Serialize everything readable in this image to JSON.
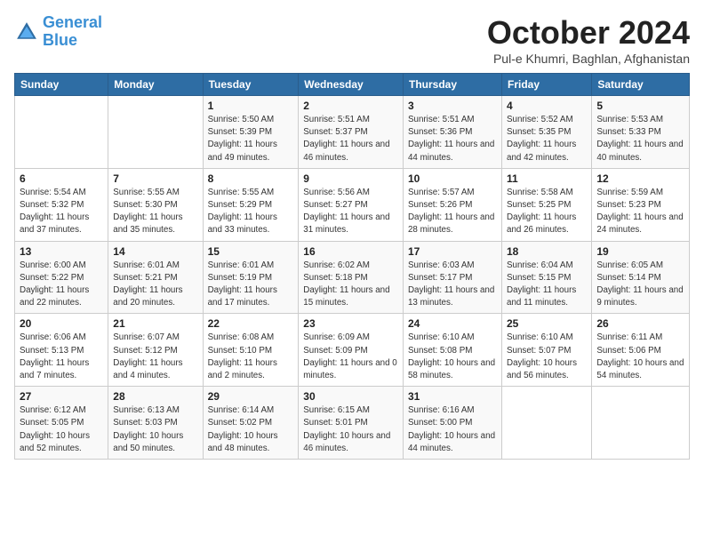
{
  "logo": {
    "line1": "General",
    "line2": "Blue"
  },
  "title": "October 2024",
  "subtitle": "Pul-e Khumri, Baghlan, Afghanistan",
  "weekdays": [
    "Sunday",
    "Monday",
    "Tuesday",
    "Wednesday",
    "Thursday",
    "Friday",
    "Saturday"
  ],
  "weeks": [
    [
      null,
      null,
      {
        "day": "1",
        "sunrise": "Sunrise: 5:50 AM",
        "sunset": "Sunset: 5:39 PM",
        "daylight": "Daylight: 11 hours and 49 minutes."
      },
      {
        "day": "2",
        "sunrise": "Sunrise: 5:51 AM",
        "sunset": "Sunset: 5:37 PM",
        "daylight": "Daylight: 11 hours and 46 minutes."
      },
      {
        "day": "3",
        "sunrise": "Sunrise: 5:51 AM",
        "sunset": "Sunset: 5:36 PM",
        "daylight": "Daylight: 11 hours and 44 minutes."
      },
      {
        "day": "4",
        "sunrise": "Sunrise: 5:52 AM",
        "sunset": "Sunset: 5:35 PM",
        "daylight": "Daylight: 11 hours and 42 minutes."
      },
      {
        "day": "5",
        "sunrise": "Sunrise: 5:53 AM",
        "sunset": "Sunset: 5:33 PM",
        "daylight": "Daylight: 11 hours and 40 minutes."
      }
    ],
    [
      {
        "day": "6",
        "sunrise": "Sunrise: 5:54 AM",
        "sunset": "Sunset: 5:32 PM",
        "daylight": "Daylight: 11 hours and 37 minutes."
      },
      {
        "day": "7",
        "sunrise": "Sunrise: 5:55 AM",
        "sunset": "Sunset: 5:30 PM",
        "daylight": "Daylight: 11 hours and 35 minutes."
      },
      {
        "day": "8",
        "sunrise": "Sunrise: 5:55 AM",
        "sunset": "Sunset: 5:29 PM",
        "daylight": "Daylight: 11 hours and 33 minutes."
      },
      {
        "day": "9",
        "sunrise": "Sunrise: 5:56 AM",
        "sunset": "Sunset: 5:27 PM",
        "daylight": "Daylight: 11 hours and 31 minutes."
      },
      {
        "day": "10",
        "sunrise": "Sunrise: 5:57 AM",
        "sunset": "Sunset: 5:26 PM",
        "daylight": "Daylight: 11 hours and 28 minutes."
      },
      {
        "day": "11",
        "sunrise": "Sunrise: 5:58 AM",
        "sunset": "Sunset: 5:25 PM",
        "daylight": "Daylight: 11 hours and 26 minutes."
      },
      {
        "day": "12",
        "sunrise": "Sunrise: 5:59 AM",
        "sunset": "Sunset: 5:23 PM",
        "daylight": "Daylight: 11 hours and 24 minutes."
      }
    ],
    [
      {
        "day": "13",
        "sunrise": "Sunrise: 6:00 AM",
        "sunset": "Sunset: 5:22 PM",
        "daylight": "Daylight: 11 hours and 22 minutes."
      },
      {
        "day": "14",
        "sunrise": "Sunrise: 6:01 AM",
        "sunset": "Sunset: 5:21 PM",
        "daylight": "Daylight: 11 hours and 20 minutes."
      },
      {
        "day": "15",
        "sunrise": "Sunrise: 6:01 AM",
        "sunset": "Sunset: 5:19 PM",
        "daylight": "Daylight: 11 hours and 17 minutes."
      },
      {
        "day": "16",
        "sunrise": "Sunrise: 6:02 AM",
        "sunset": "Sunset: 5:18 PM",
        "daylight": "Daylight: 11 hours and 15 minutes."
      },
      {
        "day": "17",
        "sunrise": "Sunrise: 6:03 AM",
        "sunset": "Sunset: 5:17 PM",
        "daylight": "Daylight: 11 hours and 13 minutes."
      },
      {
        "day": "18",
        "sunrise": "Sunrise: 6:04 AM",
        "sunset": "Sunset: 5:15 PM",
        "daylight": "Daylight: 11 hours and 11 minutes."
      },
      {
        "day": "19",
        "sunrise": "Sunrise: 6:05 AM",
        "sunset": "Sunset: 5:14 PM",
        "daylight": "Daylight: 11 hours and 9 minutes."
      }
    ],
    [
      {
        "day": "20",
        "sunrise": "Sunrise: 6:06 AM",
        "sunset": "Sunset: 5:13 PM",
        "daylight": "Daylight: 11 hours and 7 minutes."
      },
      {
        "day": "21",
        "sunrise": "Sunrise: 6:07 AM",
        "sunset": "Sunset: 5:12 PM",
        "daylight": "Daylight: 11 hours and 4 minutes."
      },
      {
        "day": "22",
        "sunrise": "Sunrise: 6:08 AM",
        "sunset": "Sunset: 5:10 PM",
        "daylight": "Daylight: 11 hours and 2 minutes."
      },
      {
        "day": "23",
        "sunrise": "Sunrise: 6:09 AM",
        "sunset": "Sunset: 5:09 PM",
        "daylight": "Daylight: 11 hours and 0 minutes."
      },
      {
        "day": "24",
        "sunrise": "Sunrise: 6:10 AM",
        "sunset": "Sunset: 5:08 PM",
        "daylight": "Daylight: 10 hours and 58 minutes."
      },
      {
        "day": "25",
        "sunrise": "Sunrise: 6:10 AM",
        "sunset": "Sunset: 5:07 PM",
        "daylight": "Daylight: 10 hours and 56 minutes."
      },
      {
        "day": "26",
        "sunrise": "Sunrise: 6:11 AM",
        "sunset": "Sunset: 5:06 PM",
        "daylight": "Daylight: 10 hours and 54 minutes."
      }
    ],
    [
      {
        "day": "27",
        "sunrise": "Sunrise: 6:12 AM",
        "sunset": "Sunset: 5:05 PM",
        "daylight": "Daylight: 10 hours and 52 minutes."
      },
      {
        "day": "28",
        "sunrise": "Sunrise: 6:13 AM",
        "sunset": "Sunset: 5:03 PM",
        "daylight": "Daylight: 10 hours and 50 minutes."
      },
      {
        "day": "29",
        "sunrise": "Sunrise: 6:14 AM",
        "sunset": "Sunset: 5:02 PM",
        "daylight": "Daylight: 10 hours and 48 minutes."
      },
      {
        "day": "30",
        "sunrise": "Sunrise: 6:15 AM",
        "sunset": "Sunset: 5:01 PM",
        "daylight": "Daylight: 10 hours and 46 minutes."
      },
      {
        "day": "31",
        "sunrise": "Sunrise: 6:16 AM",
        "sunset": "Sunset: 5:00 PM",
        "daylight": "Daylight: 10 hours and 44 minutes."
      },
      null,
      null
    ]
  ]
}
